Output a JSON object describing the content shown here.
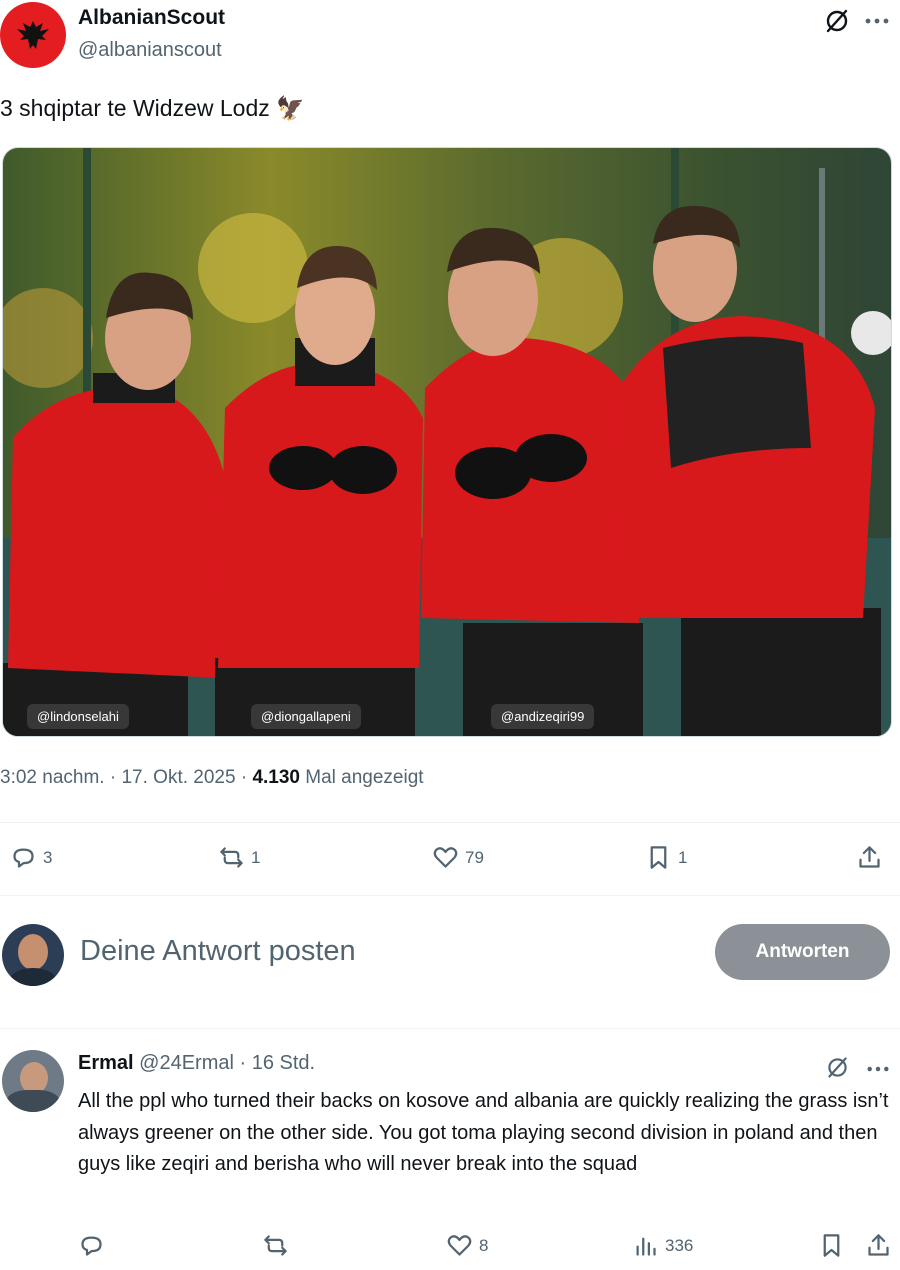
{
  "tweet": {
    "display_name": "AlbanianScout",
    "handle": "@albanianscout",
    "text": "3 shqiptar te Widzew Lodz",
    "emoji": "🦅",
    "photo_tags": [
      "@lindonselahi",
      "@diongallapeni",
      "@andizeqiri99"
    ],
    "time": "3:02 nachm.",
    "separator": " · ",
    "date": "17. Okt. 2025",
    "views_count": "4.130",
    "views_label": "Mal angezeigt",
    "actions": {
      "replies": "3",
      "reposts": "1",
      "likes": "79",
      "bookmarks": "1"
    }
  },
  "compose": {
    "placeholder": "Deine Antwort posten",
    "button_label": "Antworten"
  },
  "reply": {
    "display_name": "Ermal",
    "handle": "@24Ermal",
    "separator": " · ",
    "age": "16 Std.",
    "text": "All the ppl who turned their backs on kosove  and albania are quickly realizing the grass isn’t always greener on the other side. You got toma playing second division in poland and then guys like zeqiri and berisha who will never break into the squad",
    "actions": {
      "replies": "",
      "reposts": "",
      "likes": "8",
      "views": "336"
    }
  },
  "colors": {
    "text": "#0f1419",
    "muted": "#536471",
    "flag_red": "#e41e20",
    "jacket_red": "#d8191c",
    "button_gray": "#8b9196"
  },
  "icons": [
    "albanian-eagle-icon",
    "grok-icon",
    "more-icon",
    "reply-icon",
    "repost-icon",
    "like-icon",
    "bookmark-icon",
    "share-icon",
    "views-icon"
  ]
}
